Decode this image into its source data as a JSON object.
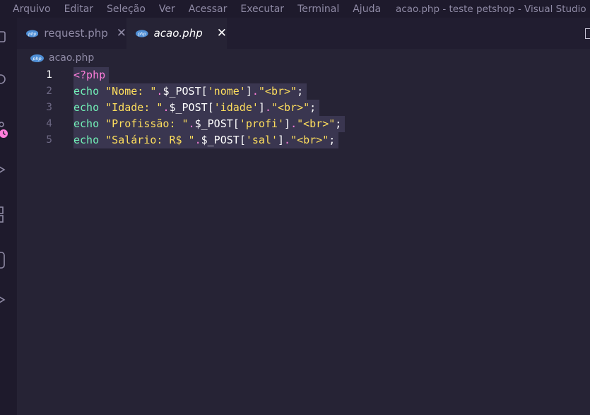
{
  "menu": {
    "items": [
      "Arquivo",
      "Editar",
      "Seleção",
      "Ver",
      "Acessar",
      "Executar",
      "Terminal",
      "Ajuda"
    ],
    "window_title": "acao.php - teste petshop - Visual Studio ..."
  },
  "tabs": [
    {
      "label": "request.php",
      "active": false
    },
    {
      "label": "acao.php",
      "active": true
    }
  ],
  "breadcrumb": {
    "file": "acao.php"
  },
  "editor": {
    "active_line": 1,
    "lines": [
      {
        "num": "1",
        "tokens": [
          {
            "t": "<?php",
            "c": "t-tag"
          }
        ]
      },
      {
        "num": "2",
        "tokens": [
          {
            "t": "echo ",
            "c": "t-kw"
          },
          {
            "t": "\"Nome: \"",
            "c": "t-str"
          },
          {
            "t": ".",
            "c": "t-dot"
          },
          {
            "t": "$_POST",
            "c": "t-var"
          },
          {
            "t": "[",
            "c": "t-plain"
          },
          {
            "t": "'nome'",
            "c": "t-str"
          },
          {
            "t": "]",
            "c": "t-plain"
          },
          {
            "t": ".",
            "c": "t-dot"
          },
          {
            "t": "\"<br>\"",
            "c": "t-str"
          },
          {
            "t": ";",
            "c": "t-plain"
          }
        ]
      },
      {
        "num": "3",
        "tokens": [
          {
            "t": "echo ",
            "c": "t-kw"
          },
          {
            "t": "\"Idade: \"",
            "c": "t-str"
          },
          {
            "t": ".",
            "c": "t-dot"
          },
          {
            "t": "$_POST",
            "c": "t-var"
          },
          {
            "t": "[",
            "c": "t-plain"
          },
          {
            "t": "'idade'",
            "c": "t-str"
          },
          {
            "t": "]",
            "c": "t-plain"
          },
          {
            "t": ".",
            "c": "t-dot"
          },
          {
            "t": "\"<br>\"",
            "c": "t-str"
          },
          {
            "t": ";",
            "c": "t-plain"
          }
        ]
      },
      {
        "num": "4",
        "tokens": [
          {
            "t": "echo ",
            "c": "t-kw"
          },
          {
            "t": "\"Profissão: \"",
            "c": "t-str"
          },
          {
            "t": ".",
            "c": "t-dot"
          },
          {
            "t": "$_POST",
            "c": "t-var"
          },
          {
            "t": "[",
            "c": "t-plain"
          },
          {
            "t": "'profi'",
            "c": "t-str"
          },
          {
            "t": "]",
            "c": "t-plain"
          },
          {
            "t": ".",
            "c": "t-dot"
          },
          {
            "t": "\"<br>\"",
            "c": "t-str"
          },
          {
            "t": ";",
            "c": "t-plain"
          }
        ]
      },
      {
        "num": "5",
        "tokens": [
          {
            "t": "echo ",
            "c": "t-kw"
          },
          {
            "t": "\"Salário: R$ \"",
            "c": "t-str"
          },
          {
            "t": ".",
            "c": "t-dot"
          },
          {
            "t": "$_POST",
            "c": "t-var"
          },
          {
            "t": "[",
            "c": "t-plain"
          },
          {
            "t": "'sal'",
            "c": "t-str"
          },
          {
            "t": "]",
            "c": "t-plain"
          },
          {
            "t": ".",
            "c": "t-dot"
          },
          {
            "t": "\"<br>\"",
            "c": "t-str"
          },
          {
            "t": ";",
            "c": "t-plain"
          }
        ]
      }
    ]
  },
  "colors": {
    "editor_bg": "#262335",
    "tag": "#ff7edb",
    "keyword": "#72f1b8",
    "string": "#fede5d"
  }
}
